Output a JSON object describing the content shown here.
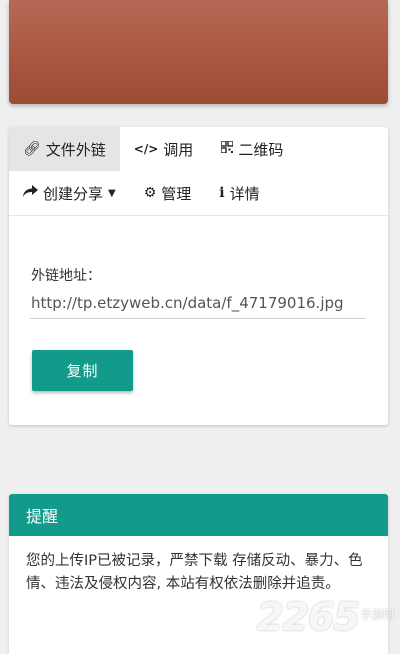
{
  "tabs_row1": [
    {
      "icon": "link-icon",
      "label": "文件外链",
      "active": true
    },
    {
      "icon": "code-icon",
      "label": "调用",
      "active": false
    },
    {
      "icon": "qrcode-icon",
      "label": "二维码",
      "active": false
    }
  ],
  "tabs_row2": [
    {
      "icon": "share-icon",
      "label": "创建分享",
      "dropdown": true
    },
    {
      "icon": "gear-icon",
      "label": "管理"
    },
    {
      "icon": "info-icon",
      "label": "详情"
    }
  ],
  "link_panel": {
    "address_label": "外链地址：",
    "url": "http://tp.etzyweb.cn/data/f_47179016.jpg",
    "copy_label": "复制"
  },
  "notice": {
    "title": "提醒",
    "body": "您的上传IP已被记录，严禁下载 存储反动、暴力、色情、违法及侵权内容, 本站有权依法删除并追责。"
  },
  "watermark": {
    "number": "2265",
    "suffix": "手游网"
  },
  "colors": {
    "accent": "#129a8a",
    "hero": "#a9573f",
    "active_tab": "#e3e5e6"
  }
}
